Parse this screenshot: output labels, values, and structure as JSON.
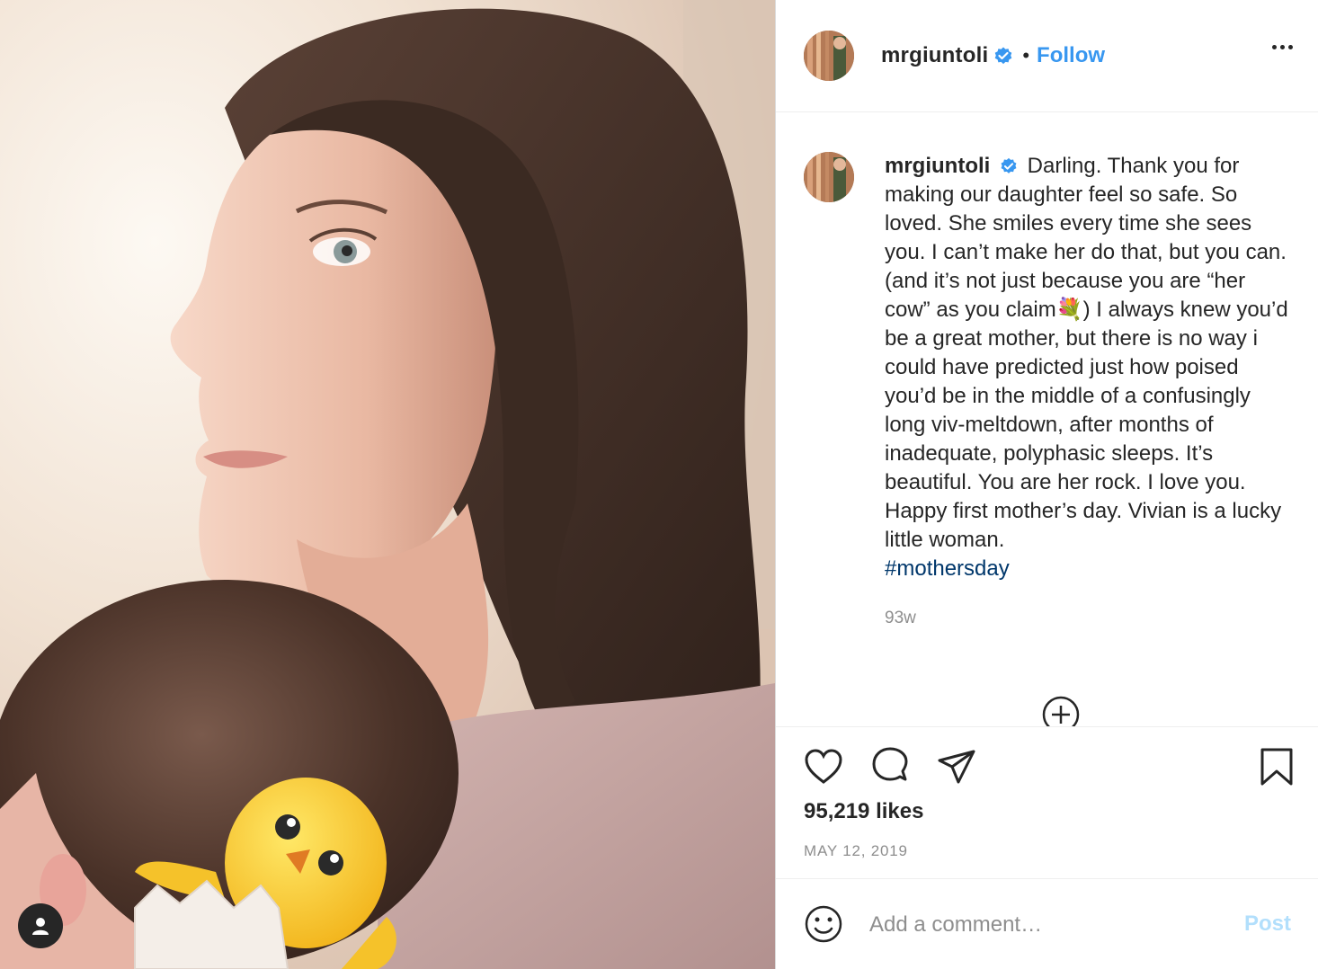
{
  "post": {
    "username": "mrgiuntoli",
    "verified": true,
    "follow_label": "Follow",
    "separator": "•",
    "caption": {
      "username": "mrgiuntoli",
      "text": "Darling. Thank you for making our daughter feel so safe. So loved. She smiles every time she sees you. I can’t make her do that, but you can. (and it’s not just because you are “her cow” as you claim💐) I always knew you’d be a great mother, but there is no way i could have predicted just how poised you’d be in the middle of a confusingly long viv-meltdown, after months of inadequate, polyphasic sleeps. It’s beautiful. You are her rock. I love you. Happy first mother’s day. Vivian is a lucky little woman.",
      "hashtag": "#mothersday",
      "time_ago": "93w"
    },
    "likes": "95,219 likes",
    "date": "MAY 12, 2019",
    "comment_placeholder": "Add a comment…",
    "post_button": "Post",
    "icons": {
      "more": "more-options-icon",
      "like": "heart-icon",
      "comment": "comment-bubble-icon",
      "share": "paper-plane-icon",
      "save": "bookmark-icon",
      "emoji": "smiley-icon",
      "load_more": "plus-circle-icon",
      "tagged_user": "user-tag-icon",
      "sticker": "hatching-chick-sticker"
    },
    "colors": {
      "link": "#3897f0",
      "hashtag": "#00376b",
      "muted": "#8e8e8e",
      "post_disabled": "#b2dffc",
      "verified": "#3897f0"
    }
  }
}
